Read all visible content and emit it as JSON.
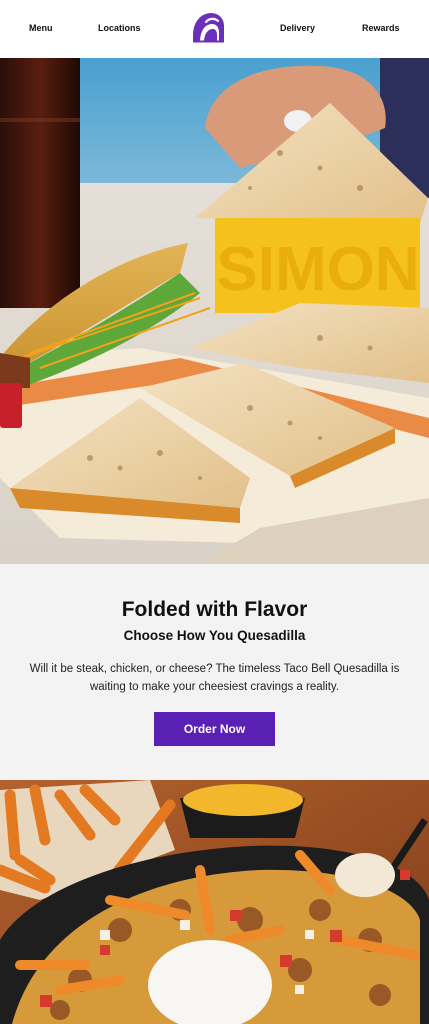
{
  "nav": {
    "menu": "Menu",
    "locations": "Locations",
    "delivery": "Delivery",
    "rewards": "Rewards",
    "brand_color": "#6b2fbb"
  },
  "hero": {
    "overlay_text": "SIMON"
  },
  "promo": {
    "title": "Folded with Flavor",
    "subtitle": "Choose How You Quesadilla",
    "body": "Will it be steak, chicken, or cheese? The timeless Taco Bell Quesadilla is waiting to make your cheesiest cravings a reality.",
    "cta_label": "Order Now",
    "cta_color": "#5a1fb3",
    "background": "#f3f3f3"
  }
}
